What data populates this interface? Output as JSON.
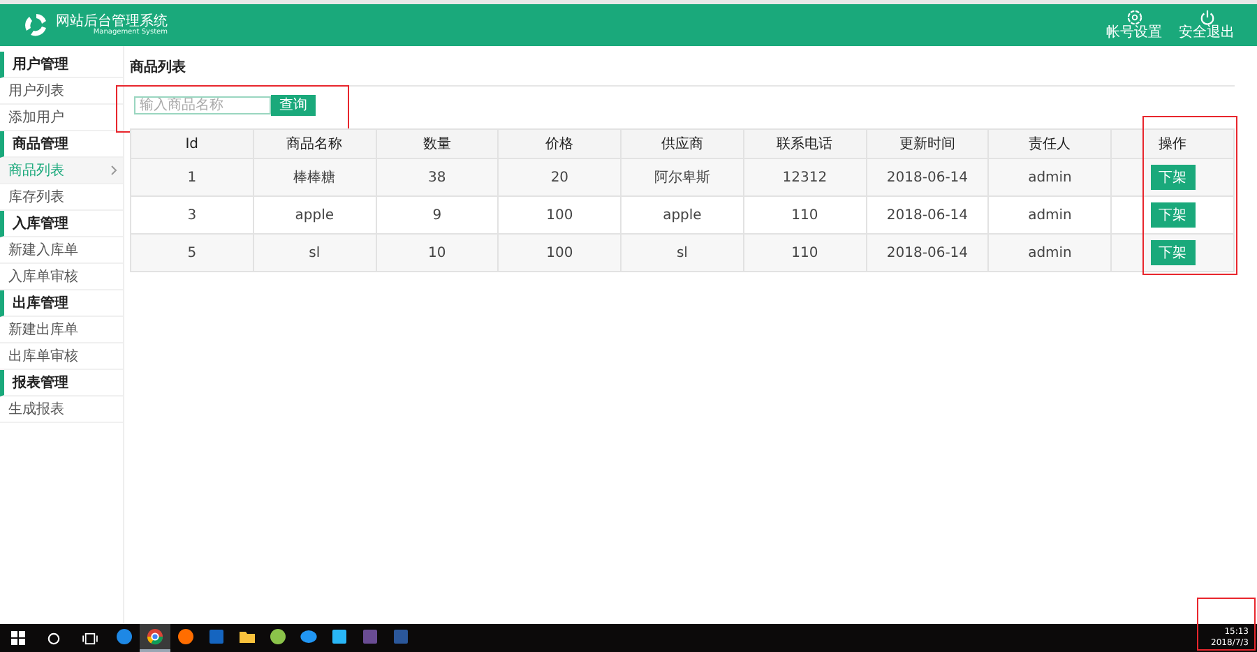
{
  "header": {
    "title": "网站后台管理系统",
    "subtitle": "Management System",
    "actions": [
      {
        "kind": "settings",
        "label": "帐号设置"
      },
      {
        "kind": "logout",
        "label": "安全退出"
      }
    ]
  },
  "sidebar": {
    "groups": [
      {
        "label": "用户管理",
        "items": [
          {
            "label": "用户列表",
            "selected": false
          },
          {
            "label": "添加用户",
            "selected": false
          }
        ]
      },
      {
        "label": "商品管理",
        "items": [
          {
            "label": "商品列表",
            "selected": true
          },
          {
            "label": "库存列表",
            "selected": false
          }
        ]
      },
      {
        "label": "入库管理",
        "items": [
          {
            "label": "新建入库单",
            "selected": false
          },
          {
            "label": "入库单审核",
            "selected": false
          }
        ]
      },
      {
        "label": "出库管理",
        "items": [
          {
            "label": "新建出库单",
            "selected": false
          },
          {
            "label": "出库单审核",
            "selected": false
          }
        ]
      },
      {
        "label": "报表管理",
        "items": [
          {
            "label": "生成报表",
            "selected": false
          }
        ]
      }
    ]
  },
  "page_title": "商品列表",
  "search": {
    "placeholder": "输入商品名称",
    "button": "查询"
  },
  "table": {
    "columns": [
      "Id",
      "商品名称",
      "数量",
      "价格",
      "供应商",
      "联系电话",
      "更新时间",
      "责任人",
      "操作"
    ],
    "rows": [
      {
        "cells": [
          "1",
          "棒棒糖",
          "38",
          "20",
          "阿尔卑斯",
          "12312",
          "2018-06-14",
          "admin"
        ],
        "action": "下架"
      },
      {
        "cells": [
          "3",
          "apple",
          "9",
          "100",
          "apple",
          "110",
          "2018-06-14",
          "admin"
        ],
        "action": "下架"
      },
      {
        "cells": [
          "5",
          "sl",
          "10",
          "100",
          "sl",
          "110",
          "2018-06-14",
          "admin"
        ],
        "action": "下架"
      }
    ]
  },
  "taskbar": {
    "apps": [
      {
        "selected": false
      },
      {
        "selected": true
      },
      {
        "selected": false
      },
      {
        "selected": false
      },
      {
        "selected": false
      },
      {
        "selected": false
      },
      {
        "selected": false
      },
      {
        "selected": false
      },
      {
        "selected": false
      },
      {
        "selected": false
      }
    ],
    "clock": {
      "time": "15:13",
      "date": "2018/7/3"
    }
  }
}
